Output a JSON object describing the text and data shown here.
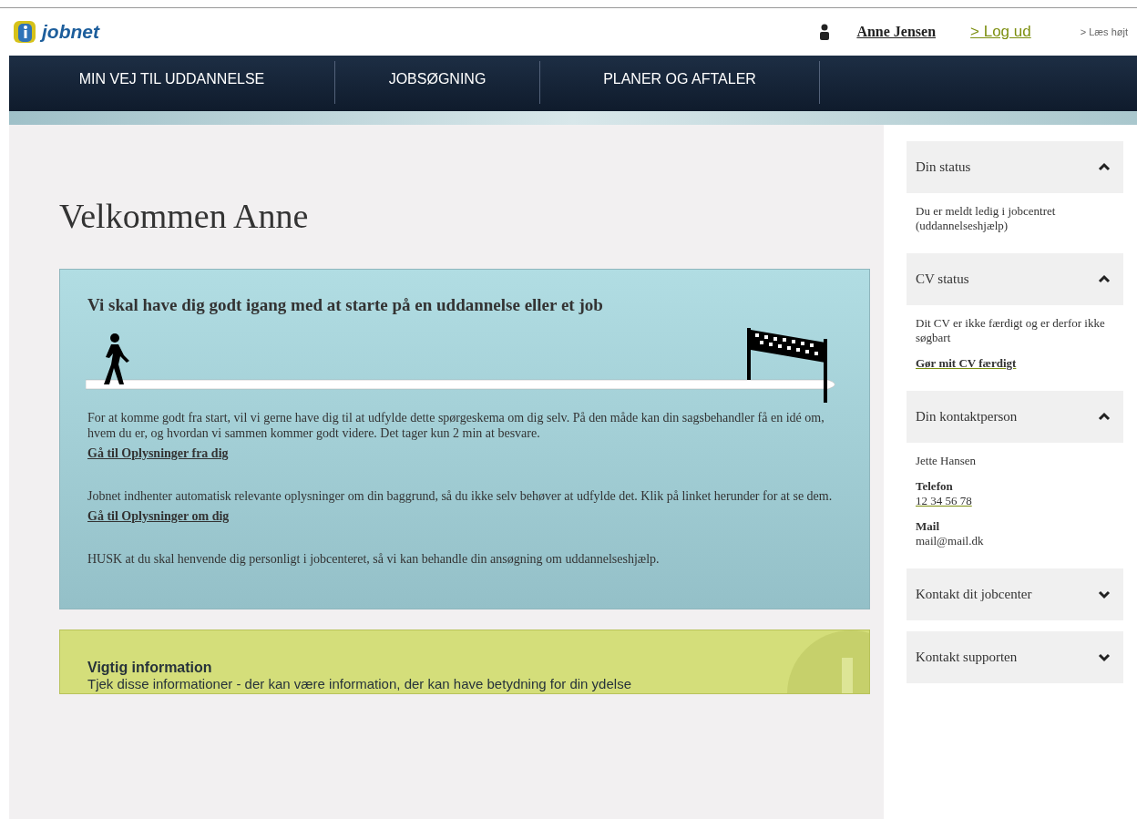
{
  "header": {
    "logo": "jobnet",
    "user_name": "Anne Jensen",
    "logout": "> Log ud",
    "read_aloud": "> Læs højt"
  },
  "nav": {
    "items": [
      {
        "label": "MIN VEJ TIL UDDANNELSE"
      },
      {
        "label": "JOBSØGNING"
      },
      {
        "label": "PLANER OG AFTALER"
      }
    ]
  },
  "main": {
    "heading": "Velkommen Anne",
    "progress_card": {
      "title": "Vi skal have dig godt igang med at starte på en uddannelse eller et job",
      "sections": [
        {
          "text": "For at komme godt fra start, vil vi gerne have dig til at udfylde dette spørgeskema om dig selv. På den måde kan din sagsbehandler få en idé om, hvem du er, og hvordan vi sammen kommer godt videre. Det tager kun 2 min at besvare.",
          "link": "Gå til Oplysninger fra dig"
        },
        {
          "text": "Jobnet indhenter automatisk relevante oplysninger om din baggrund, så du ikke selv behøver at udfylde det. Klik på linket herunder for at se dem.",
          "link": "Gå til Oplysninger om dig"
        },
        {
          "text": "HUSK at du skal henvende dig personligt i jobcenteret, så vi kan behandle din ansøgning om uddannelseshjælp."
        }
      ]
    },
    "info_card": {
      "title": "Vigtig information",
      "text": "Tjek disse informationer - der kan være information, der kan have betydning for din ydelse"
    }
  },
  "sidebar": {
    "panels": [
      {
        "title": "Din status",
        "expanded": true,
        "body": [
          {
            "kind": "text",
            "text": "Du er meldt ledig i jobcentret (uddannelseshjælp)"
          }
        ]
      },
      {
        "title": "CV status",
        "expanded": true,
        "body": [
          {
            "kind": "text",
            "text": "Dit CV er ikke færdigt og er derfor ikke søgbart"
          },
          {
            "kind": "link",
            "text": "Gør mit CV færdigt"
          }
        ]
      },
      {
        "title": "Din kontaktperson",
        "expanded": true,
        "body": [
          {
            "kind": "text",
            "text": "Jette Hansen"
          },
          {
            "kind": "field",
            "label": "Telefon",
            "value": "12 34 56 78",
            "link": true
          },
          {
            "kind": "field",
            "label": "Mail",
            "value": "mail@mail.dk",
            "link": false
          }
        ]
      },
      {
        "title": "Kontakt dit jobcenter",
        "expanded": false
      },
      {
        "title": "Kontakt supporten",
        "expanded": false
      }
    ]
  }
}
